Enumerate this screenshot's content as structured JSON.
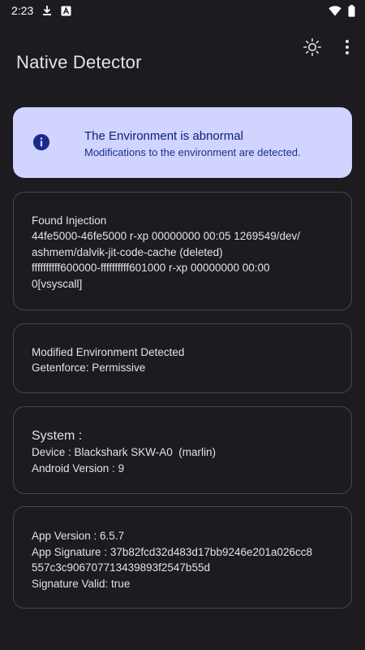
{
  "status_bar": {
    "time": "2:23",
    "icons": [
      "download-icon",
      "font-app-icon",
      "wifi-icon",
      "battery-icon"
    ]
  },
  "app_bar": {
    "title": "Native Detector",
    "actions": [
      "theme-toggle-sun-icon",
      "more-vert-icon"
    ]
  },
  "banner": {
    "icon": "info-icon",
    "title": "The Environment is abnormal",
    "subtitle": "Modifications to the environment are detected.",
    "bg_color": "#d0d4ff",
    "text_color": "#0f1c7a"
  },
  "cards": {
    "injection": {
      "heading": "Found Injection",
      "lines": [
        "44fe5000-46fe5000 r-xp 00000000 00:05 1269549/dev/",
        "ashmem/dalvik-jit-code-cache (deleted)",
        "ffffffffff600000-ffffffffff601000 r-xp 00000000 00:00",
        "0[vsyscall]"
      ]
    },
    "modified": {
      "heading": "Modified Environment Detected",
      "lines": [
        "Getenforce: Permissive"
      ]
    },
    "system": {
      "heading": "System :",
      "lines": [
        "Device : Blackshark SKW-A0  (marlin)",
        "Android Version : 9"
      ]
    },
    "app": {
      "lines": [
        "App Version : 6.5.7",
        "App Signature : 37b82fcd32d483d17bb9246e201a026cc8",
        "557c3c906707713439893f2547b55d",
        "Signature Valid: true"
      ]
    }
  }
}
